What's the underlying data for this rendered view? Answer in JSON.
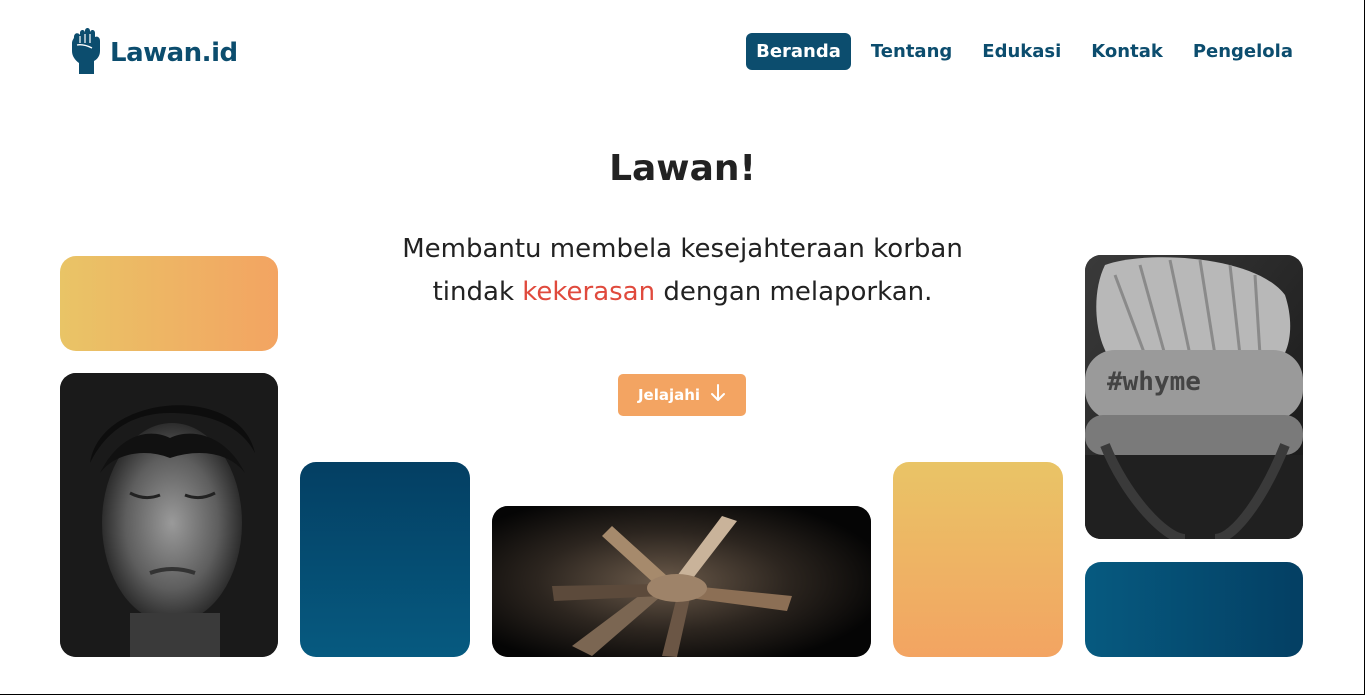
{
  "brand": {
    "name": "Lawan.id",
    "icon": "raised-fist-icon",
    "color": "#0c4d6e"
  },
  "nav": {
    "items": [
      {
        "label": "Beranda",
        "active": true
      },
      {
        "label": "Tentang",
        "active": false
      },
      {
        "label": "Edukasi",
        "active": false
      },
      {
        "label": "Kontak",
        "active": false
      },
      {
        "label": "Pengelola",
        "active": false
      }
    ]
  },
  "hero": {
    "title": "Lawan!",
    "subtitle_part1": "Membantu membela kesejahteraan korban tindak ",
    "subtitle_highlight": "kekerasan",
    "subtitle_part2": " dengan melaporkan.",
    "cta_label": "Jelajahi",
    "cta_icon": "arrow-down-icon"
  },
  "photos": {
    "crying_child_alt": "crying-child-photo",
    "hands_together_alt": "hands-together-photo",
    "whyme_text": "#whyme"
  },
  "colors": {
    "primary": "#0c4d6e",
    "accent": "#f3a462",
    "highlight": "#e04a3d",
    "gold": "#e9c466"
  }
}
